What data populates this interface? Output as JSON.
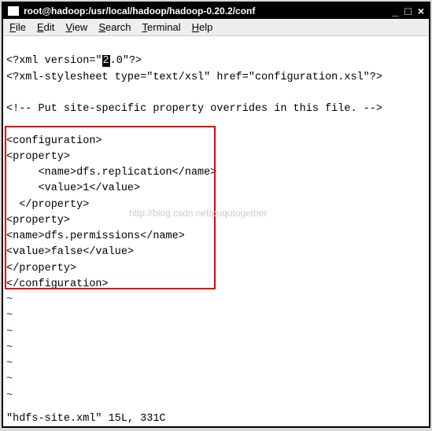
{
  "titlebar": {
    "title": "root@hadoop:/usr/local/hadoop/hadoop-0.20.2/conf"
  },
  "menu": {
    "file": "File",
    "edit": "Edit",
    "view": "View",
    "search": "Search",
    "terminal": "Terminal",
    "help": "Help"
  },
  "editor": {
    "lines": {
      "l1a": "<?xml version=\"",
      "l1cursor": "2",
      "l1b": ".0\"?>",
      "l2": "<?xml-stylesheet type=\"text/xsl\" href=\"configuration.xsl\"?>",
      "l3": "",
      "l4": "<!-- Put site-specific property overrides in this file. -->",
      "l5": "",
      "l6": "<configuration>",
      "l7": "<property>",
      "l8": "     <name>dfs.replication</name>",
      "l9": "     <value>1</value>",
      "l10": "  </property>",
      "l11": "<property>",
      "l12": "<name>dfs.permissions</name>",
      "l13": "<value>false</value>",
      "l14": "</property>",
      "l15": "</configuration>"
    },
    "tilde": "~",
    "watermark": "http://blog.csdn.net/puqutogether"
  },
  "status": {
    "text": "\"hdfs-site.xml\" 15L, 331C"
  }
}
